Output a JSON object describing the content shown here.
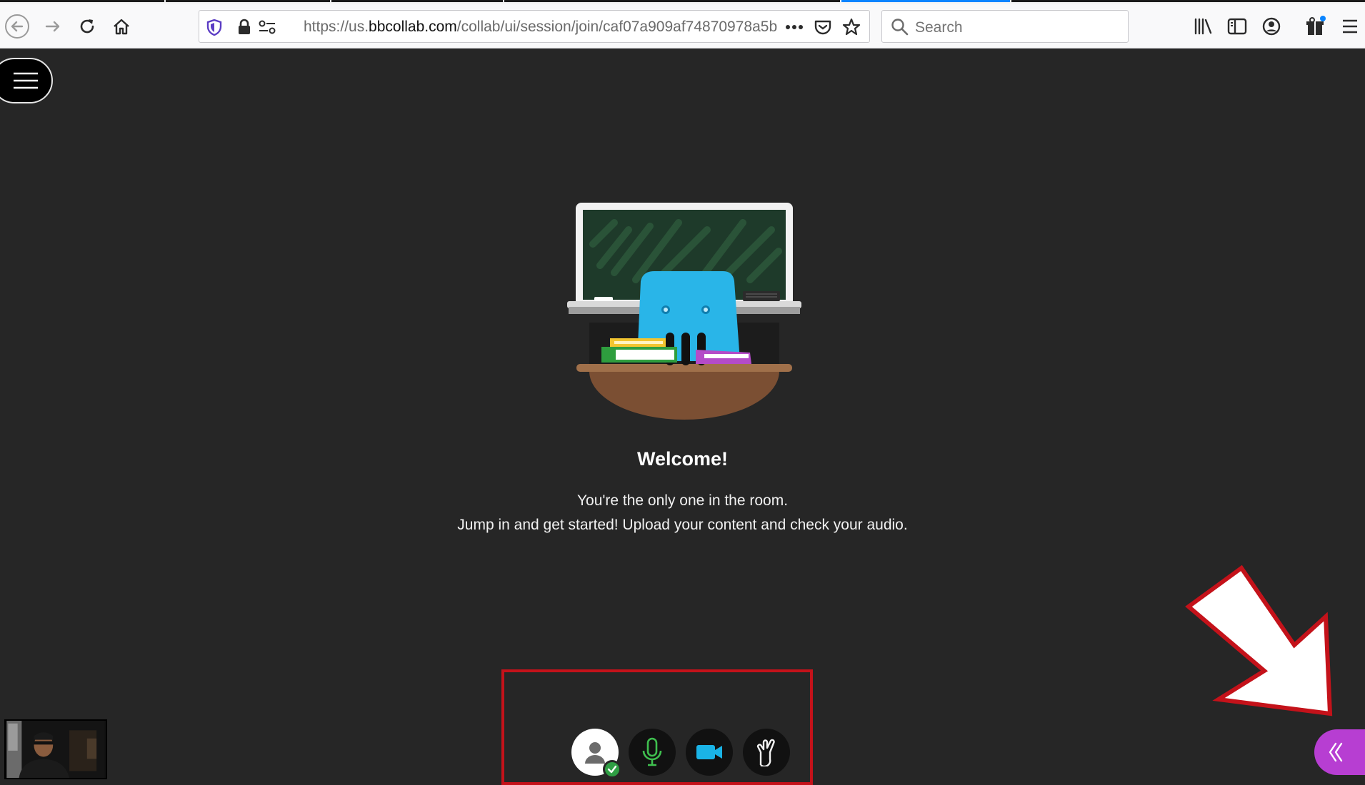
{
  "browser": {
    "url_prefix": "https://us.",
    "url_host": "bbcollab.com",
    "url_path": "/collab/ui/session/join/caf07a909af74870978a5b",
    "search_placeholder": "Search",
    "icons": [
      "back-icon",
      "forward-icon",
      "reload-icon",
      "home-icon",
      "shield-icon",
      "lock-icon",
      "permissions-icon",
      "more-icon",
      "pocket-icon",
      "star-icon",
      "search-icon",
      "library-icon",
      "sidebar-icon",
      "account-icon",
      "extensions-icon",
      "menu-icon"
    ]
  },
  "session": {
    "welcome_title": "Welcome!",
    "message_line1": "You're the only one in the room.",
    "message_line2": "Jump in and get started! Upload your content and check your audio.",
    "controls": [
      "avatar-status",
      "microphone",
      "camera",
      "raise-hand"
    ]
  },
  "colors": {
    "background": "#262626",
    "annotation_red": "#c4121a",
    "collab_panel_purple": "#b73ed2",
    "mic_green": "#3fbf4f",
    "camera_blue": "#1ab3e6"
  }
}
